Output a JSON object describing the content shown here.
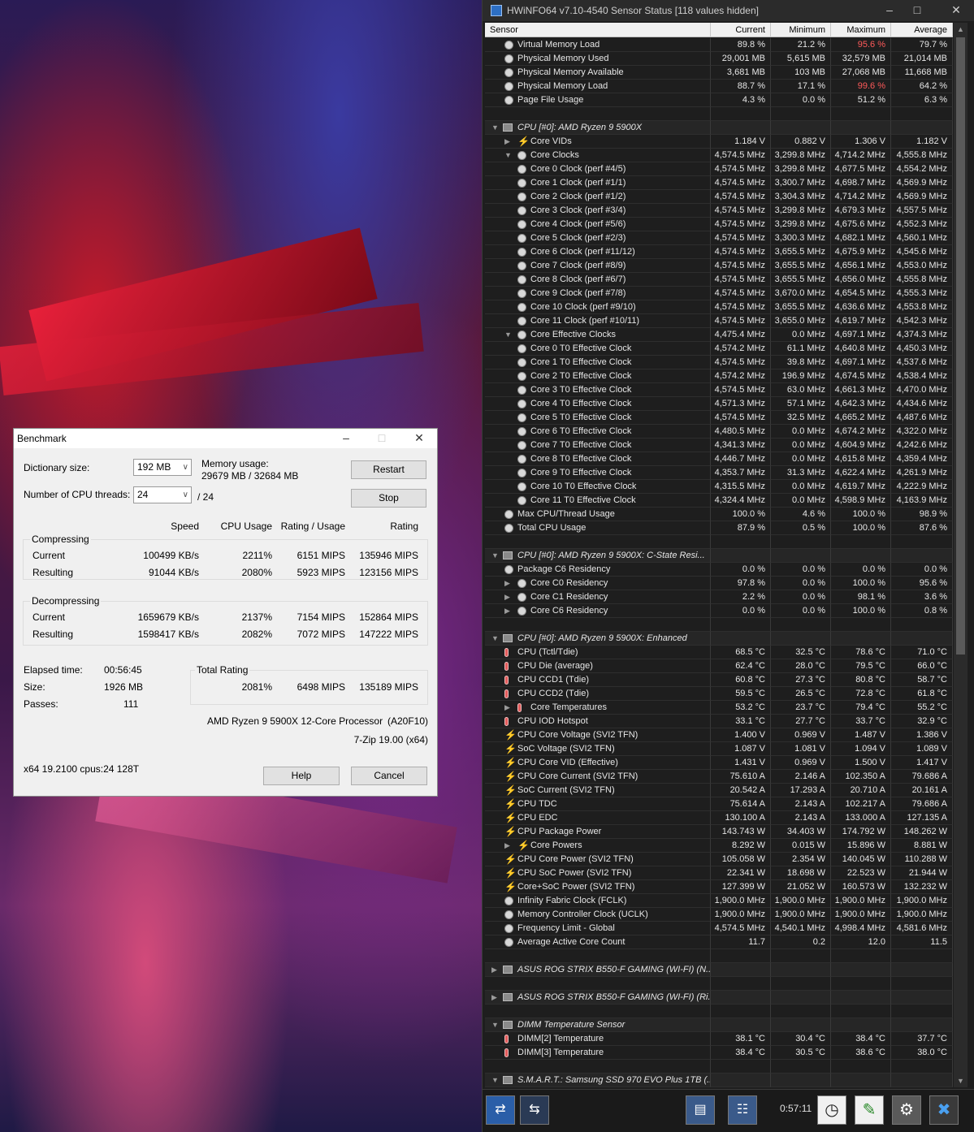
{
  "hwinfo": {
    "title": "HWiNFO64 v7.10-4540 Sensor Status [118 values hidden]",
    "columns": [
      "Sensor",
      "Current",
      "Minimum",
      "Maximum",
      "Average"
    ],
    "rows": [
      {
        "k": "s",
        "ic": "circ",
        "lv": 1,
        "n": "Virtual Memory Load",
        "v": [
          "89.8 %",
          "21.2 %",
          "95.6 %",
          "79.7 %"
        ],
        "hot": [
          false,
          false,
          true,
          false
        ]
      },
      {
        "k": "s",
        "ic": "circ",
        "lv": 1,
        "n": "Physical Memory Used",
        "v": [
          "29,001 MB",
          "5,615 MB",
          "32,579 MB",
          "21,014 MB"
        ]
      },
      {
        "k": "s",
        "ic": "circ",
        "lv": 1,
        "n": "Physical Memory Available",
        "v": [
          "3,681 MB",
          "103 MB",
          "27,068 MB",
          "11,668 MB"
        ]
      },
      {
        "k": "s",
        "ic": "circ",
        "lv": 1,
        "n": "Physical Memory Load",
        "v": [
          "88.7 %",
          "17.1 %",
          "99.6 %",
          "64.2 %"
        ],
        "hot": [
          false,
          false,
          true,
          false
        ]
      },
      {
        "k": "s",
        "ic": "circ",
        "lv": 1,
        "n": "Page File Usage",
        "v": [
          "4.3 %",
          "0.0 %",
          "51.2 %",
          "6.3 %"
        ]
      },
      {
        "k": "b"
      },
      {
        "k": "g",
        "n": "CPU [#0]: AMD Ryzen 9 5900X",
        "open": true
      },
      {
        "k": "s",
        "ic": "bolt",
        "lv": 2,
        "ar": "▶",
        "n": "Core VIDs",
        "v": [
          "1.184 V",
          "0.882 V",
          "1.306 V",
          "1.182 V"
        ]
      },
      {
        "k": "s",
        "ic": "circ",
        "lv": 2,
        "ar": "▼",
        "n": "Core Clocks",
        "v": [
          "4,574.5 MHz",
          "3,299.8 MHz",
          "4,714.2 MHz",
          "4,555.8 MHz"
        ]
      },
      {
        "k": "s",
        "ic": "circ",
        "lv": 3,
        "n": "Core 0 Clock (perf #4/5)",
        "v": [
          "4,574.5 MHz",
          "3,299.8 MHz",
          "4,677.5 MHz",
          "4,554.2 MHz"
        ]
      },
      {
        "k": "s",
        "ic": "circ",
        "lv": 3,
        "n": "Core 1 Clock (perf #1/1)",
        "v": [
          "4,574.5 MHz",
          "3,300.7 MHz",
          "4,698.7 MHz",
          "4,569.9 MHz"
        ]
      },
      {
        "k": "s",
        "ic": "circ",
        "lv": 3,
        "n": "Core 2 Clock (perf #1/2)",
        "v": [
          "4,574.5 MHz",
          "3,304.3 MHz",
          "4,714.2 MHz",
          "4,569.9 MHz"
        ]
      },
      {
        "k": "s",
        "ic": "circ",
        "lv": 3,
        "n": "Core 3 Clock (perf #3/4)",
        "v": [
          "4,574.5 MHz",
          "3,299.8 MHz",
          "4,679.3 MHz",
          "4,557.5 MHz"
        ]
      },
      {
        "k": "s",
        "ic": "circ",
        "lv": 3,
        "n": "Core 4 Clock (perf #5/6)",
        "v": [
          "4,574.5 MHz",
          "3,299.8 MHz",
          "4,675.6 MHz",
          "4,552.3 MHz"
        ]
      },
      {
        "k": "s",
        "ic": "circ",
        "lv": 3,
        "n": "Core 5 Clock (perf #2/3)",
        "v": [
          "4,574.5 MHz",
          "3,300.3 MHz",
          "4,682.1 MHz",
          "4,560.1 MHz"
        ]
      },
      {
        "k": "s",
        "ic": "circ",
        "lv": 3,
        "n": "Core 6 Clock (perf #11/12)",
        "v": [
          "4,574.5 MHz",
          "3,655.5 MHz",
          "4,675.9 MHz",
          "4,545.6 MHz"
        ]
      },
      {
        "k": "s",
        "ic": "circ",
        "lv": 3,
        "n": "Core 7 Clock (perf #8/9)",
        "v": [
          "4,574.5 MHz",
          "3,655.5 MHz",
          "4,656.1 MHz",
          "4,553.0 MHz"
        ]
      },
      {
        "k": "s",
        "ic": "circ",
        "lv": 3,
        "n": "Core 8 Clock (perf #6/7)",
        "v": [
          "4,574.5 MHz",
          "3,655.5 MHz",
          "4,656.0 MHz",
          "4,555.8 MHz"
        ]
      },
      {
        "k": "s",
        "ic": "circ",
        "lv": 3,
        "n": "Core 9 Clock (perf #7/8)",
        "v": [
          "4,574.5 MHz",
          "3,670.0 MHz",
          "4,654.5 MHz",
          "4,555.3 MHz"
        ]
      },
      {
        "k": "s",
        "ic": "circ",
        "lv": 3,
        "n": "Core 10 Clock (perf #9/10)",
        "v": [
          "4,574.5 MHz",
          "3,655.5 MHz",
          "4,636.6 MHz",
          "4,553.8 MHz"
        ]
      },
      {
        "k": "s",
        "ic": "circ",
        "lv": 3,
        "n": "Core 11 Clock (perf #10/11)",
        "v": [
          "4,574.5 MHz",
          "3,655.0 MHz",
          "4,619.7 MHz",
          "4,542.3 MHz"
        ]
      },
      {
        "k": "s",
        "ic": "circ",
        "lv": 2,
        "ar": "▼",
        "n": "Core Effective Clocks",
        "v": [
          "4,475.4 MHz",
          "0.0 MHz",
          "4,697.1 MHz",
          "4,374.3 MHz"
        ]
      },
      {
        "k": "s",
        "ic": "circ",
        "lv": 3,
        "n": "Core 0 T0 Effective Clock",
        "v": [
          "4,574.2 MHz",
          "61.1 MHz",
          "4,640.8 MHz",
          "4,450.3 MHz"
        ]
      },
      {
        "k": "s",
        "ic": "circ",
        "lv": 3,
        "n": "Core 1 T0 Effective Clock",
        "v": [
          "4,574.5 MHz",
          "39.8 MHz",
          "4,697.1 MHz",
          "4,537.6 MHz"
        ]
      },
      {
        "k": "s",
        "ic": "circ",
        "lv": 3,
        "n": "Core 2 T0 Effective Clock",
        "v": [
          "4,574.2 MHz",
          "196.9 MHz",
          "4,674.5 MHz",
          "4,538.4 MHz"
        ]
      },
      {
        "k": "s",
        "ic": "circ",
        "lv": 3,
        "n": "Core 3 T0 Effective Clock",
        "v": [
          "4,574.5 MHz",
          "63.0 MHz",
          "4,661.3 MHz",
          "4,470.0 MHz"
        ]
      },
      {
        "k": "s",
        "ic": "circ",
        "lv": 3,
        "n": "Core 4 T0 Effective Clock",
        "v": [
          "4,571.3 MHz",
          "57.1 MHz",
          "4,642.3 MHz",
          "4,434.6 MHz"
        ]
      },
      {
        "k": "s",
        "ic": "circ",
        "lv": 3,
        "n": "Core 5 T0 Effective Clock",
        "v": [
          "4,574.5 MHz",
          "32.5 MHz",
          "4,665.2 MHz",
          "4,487.6 MHz"
        ]
      },
      {
        "k": "s",
        "ic": "circ",
        "lv": 3,
        "n": "Core 6 T0 Effective Clock",
        "v": [
          "4,480.5 MHz",
          "0.0 MHz",
          "4,674.2 MHz",
          "4,322.0 MHz"
        ]
      },
      {
        "k": "s",
        "ic": "circ",
        "lv": 3,
        "n": "Core 7 T0 Effective Clock",
        "v": [
          "4,341.3 MHz",
          "0.0 MHz",
          "4,604.9 MHz",
          "4,242.6 MHz"
        ]
      },
      {
        "k": "s",
        "ic": "circ",
        "lv": 3,
        "n": "Core 8 T0 Effective Clock",
        "v": [
          "4,446.7 MHz",
          "0.0 MHz",
          "4,615.8 MHz",
          "4,359.4 MHz"
        ]
      },
      {
        "k": "s",
        "ic": "circ",
        "lv": 3,
        "n": "Core 9 T0 Effective Clock",
        "v": [
          "4,353.7 MHz",
          "31.3 MHz",
          "4,622.4 MHz",
          "4,261.9 MHz"
        ]
      },
      {
        "k": "s",
        "ic": "circ",
        "lv": 3,
        "n": "Core 10 T0 Effective Clock",
        "v": [
          "4,315.5 MHz",
          "0.0 MHz",
          "4,619.7 MHz",
          "4,222.9 MHz"
        ]
      },
      {
        "k": "s",
        "ic": "circ",
        "lv": 3,
        "n": "Core 11 T0 Effective Clock",
        "v": [
          "4,324.4 MHz",
          "0.0 MHz",
          "4,598.9 MHz",
          "4,163.9 MHz"
        ]
      },
      {
        "k": "s",
        "ic": "circ",
        "lv": 1,
        "n": "Max CPU/Thread Usage",
        "v": [
          "100.0 %",
          "4.6 %",
          "100.0 %",
          "98.9 %"
        ]
      },
      {
        "k": "s",
        "ic": "circ",
        "lv": 1,
        "n": "Total CPU Usage",
        "v": [
          "87.9 %",
          "0.5 %",
          "100.0 %",
          "87.6 %"
        ]
      },
      {
        "k": "b"
      },
      {
        "k": "g",
        "n": "CPU [#0]: AMD Ryzen 9 5900X: C-State Resi...",
        "open": true
      },
      {
        "k": "s",
        "ic": "circ",
        "lv": 1,
        "n": "Package C6 Residency",
        "v": [
          "0.0 %",
          "0.0 %",
          "0.0 %",
          "0.0 %"
        ]
      },
      {
        "k": "s",
        "ic": "circ",
        "lv": 2,
        "ar": "▶",
        "n": "Core C0 Residency",
        "v": [
          "97.8 %",
          "0.0 %",
          "100.0 %",
          "95.6 %"
        ]
      },
      {
        "k": "s",
        "ic": "circ",
        "lv": 2,
        "ar": "▶",
        "n": "Core C1 Residency",
        "v": [
          "2.2 %",
          "0.0 %",
          "98.1 %",
          "3.6 %"
        ]
      },
      {
        "k": "s",
        "ic": "circ",
        "lv": 2,
        "ar": "▶",
        "n": "Core C6 Residency",
        "v": [
          "0.0 %",
          "0.0 %",
          "100.0 %",
          "0.8 %"
        ]
      },
      {
        "k": "b"
      },
      {
        "k": "g",
        "n": "CPU [#0]: AMD Ryzen 9 5900X: Enhanced",
        "open": true
      },
      {
        "k": "s",
        "ic": "therm",
        "lv": 1,
        "n": "CPU (Tctl/Tdie)",
        "v": [
          "68.5 °C",
          "32.5 °C",
          "78.6 °C",
          "71.0 °C"
        ]
      },
      {
        "k": "s",
        "ic": "therm",
        "lv": 1,
        "n": "CPU Die (average)",
        "v": [
          "62.4 °C",
          "28.0 °C",
          "79.5 °C",
          "66.0 °C"
        ]
      },
      {
        "k": "s",
        "ic": "therm",
        "lv": 1,
        "n": "CPU CCD1 (Tdie)",
        "v": [
          "60.8 °C",
          "27.3 °C",
          "80.8 °C",
          "58.7 °C"
        ]
      },
      {
        "k": "s",
        "ic": "therm",
        "lv": 1,
        "n": "CPU CCD2 (Tdie)",
        "v": [
          "59.5 °C",
          "26.5 °C",
          "72.8 °C",
          "61.8 °C"
        ]
      },
      {
        "k": "s",
        "ic": "therm",
        "lv": 2,
        "ar": "▶",
        "n": "Core Temperatures",
        "v": [
          "53.2 °C",
          "23.7 °C",
          "79.4 °C",
          "55.2 °C"
        ]
      },
      {
        "k": "s",
        "ic": "therm",
        "lv": 1,
        "n": "CPU IOD Hotspot",
        "v": [
          "33.1 °C",
          "27.7 °C",
          "33.7 °C",
          "32.9 °C"
        ]
      },
      {
        "k": "s",
        "ic": "bolt",
        "lv": 1,
        "n": "CPU Core Voltage (SVI2 TFN)",
        "v": [
          "1.400 V",
          "0.969 V",
          "1.487 V",
          "1.386 V"
        ]
      },
      {
        "k": "s",
        "ic": "bolt",
        "lv": 1,
        "n": "SoC Voltage (SVI2 TFN)",
        "v": [
          "1.087 V",
          "1.081 V",
          "1.094 V",
          "1.089 V"
        ]
      },
      {
        "k": "s",
        "ic": "bolt",
        "lv": 1,
        "n": "CPU Core VID (Effective)",
        "v": [
          "1.431 V",
          "0.969 V",
          "1.500 V",
          "1.417 V"
        ]
      },
      {
        "k": "s",
        "ic": "bolt",
        "lv": 1,
        "n": "CPU Core Current (SVI2 TFN)",
        "v": [
          "75.610 A",
          "2.146 A",
          "102.350 A",
          "79.686 A"
        ]
      },
      {
        "k": "s",
        "ic": "bolt",
        "lv": 1,
        "n": "SoC Current (SVI2 TFN)",
        "v": [
          "20.542 A",
          "17.293 A",
          "20.710 A",
          "20.161 A"
        ]
      },
      {
        "k": "s",
        "ic": "bolt",
        "lv": 1,
        "n": "CPU TDC",
        "v": [
          "75.614 A",
          "2.143 A",
          "102.217 A",
          "79.686 A"
        ]
      },
      {
        "k": "s",
        "ic": "bolt",
        "lv": 1,
        "n": "CPU EDC",
        "v": [
          "130.100 A",
          "2.143 A",
          "133.000 A",
          "127.135 A"
        ]
      },
      {
        "k": "s",
        "ic": "bolt",
        "lv": 1,
        "n": "CPU Package Power",
        "v": [
          "143.743 W",
          "34.403 W",
          "174.792 W",
          "148.262 W"
        ]
      },
      {
        "k": "s",
        "ic": "bolt",
        "lv": 2,
        "ar": "▶",
        "n": "Core Powers",
        "v": [
          "8.292 W",
          "0.015 W",
          "15.896 W",
          "8.881 W"
        ]
      },
      {
        "k": "s",
        "ic": "bolt",
        "lv": 1,
        "n": "CPU Core Power (SVI2 TFN)",
        "v": [
          "105.058 W",
          "2.354 W",
          "140.045 W",
          "110.288 W"
        ]
      },
      {
        "k": "s",
        "ic": "bolt",
        "lv": 1,
        "n": "CPU SoC Power (SVI2 TFN)",
        "v": [
          "22.341 W",
          "18.698 W",
          "22.523 W",
          "21.944 W"
        ]
      },
      {
        "k": "s",
        "ic": "bolt",
        "lv": 1,
        "n": "Core+SoC Power (SVI2 TFN)",
        "v": [
          "127.399 W",
          "21.052 W",
          "160.573 W",
          "132.232 W"
        ]
      },
      {
        "k": "s",
        "ic": "circ",
        "lv": 1,
        "n": "Infinity Fabric Clock (FCLK)",
        "v": [
          "1,900.0 MHz",
          "1,900.0 MHz",
          "1,900.0 MHz",
          "1,900.0 MHz"
        ]
      },
      {
        "k": "s",
        "ic": "circ",
        "lv": 1,
        "n": "Memory Controller Clock (UCLK)",
        "v": [
          "1,900.0 MHz",
          "1,900.0 MHz",
          "1,900.0 MHz",
          "1,900.0 MHz"
        ]
      },
      {
        "k": "s",
        "ic": "circ",
        "lv": 1,
        "n": "Frequency Limit - Global",
        "v": [
          "4,574.5 MHz",
          "4,540.1 MHz",
          "4,998.4 MHz",
          "4,581.6 MHz"
        ]
      },
      {
        "k": "s",
        "ic": "circ",
        "lv": 1,
        "n": "Average Active Core Count",
        "v": [
          "11.7",
          "0.2",
          "12.0",
          "11.5"
        ]
      },
      {
        "k": "b"
      },
      {
        "k": "g",
        "n": "ASUS ROG STRIX B550-F GAMING (WI-FI) (N...",
        "open": false
      },
      {
        "k": "b"
      },
      {
        "k": "g",
        "n": "ASUS ROG STRIX B550-F GAMING (WI-FI) (Ri...",
        "open": false
      },
      {
        "k": "b"
      },
      {
        "k": "g",
        "n": "DIMM Temperature Sensor",
        "open": true
      },
      {
        "k": "s",
        "ic": "therm",
        "lv": 1,
        "n": "DIMM[2] Temperature",
        "v": [
          "38.1 °C",
          "30.4 °C",
          "38.4 °C",
          "37.7 °C"
        ]
      },
      {
        "k": "s",
        "ic": "therm",
        "lv": 1,
        "n": "DIMM[3] Temperature",
        "v": [
          "38.4 °C",
          "30.5 °C",
          "38.6 °C",
          "38.0 °C"
        ]
      },
      {
        "k": "b"
      },
      {
        "k": "g",
        "n": "S.M.A.R.T.: Samsung SSD 970 EVO Plus 1TB (...",
        "open": true
      }
    ],
    "toolbar": {
      "timer": "0:57:11"
    },
    "icons": [
      "arrows-left-right-icon",
      "arrows-collapse-icon",
      "monitor-report-icon",
      "network-icon",
      "clock-icon",
      "log-file-icon",
      "settings-gear-icon",
      "close-x-icon"
    ]
  },
  "bench": {
    "title": "Benchmark",
    "dict_label": "Dictionary size:",
    "dict_value": "192 MB",
    "mem_label": "Memory usage:",
    "mem_value": "29679 MB / 32684 MB",
    "threads_label": "Number of CPU threads:",
    "threads_value": "24",
    "threads_max": "/ 24",
    "restart": "Restart",
    "stop": "Stop",
    "headers": {
      "speed": "Speed",
      "cpu": "CPU Usage",
      "rpu": "Rating / Usage",
      "rating": "Rating"
    },
    "compressing": {
      "label": "Compressing",
      "current": {
        "label": "Current",
        "speed": "100499 KB/s",
        "cpu": "2211%",
        "rpu": "6151 MIPS",
        "rating": "135946 MIPS"
      },
      "resulting": {
        "label": "Resulting",
        "speed": "91044 KB/s",
        "cpu": "2080%",
        "rpu": "5923 MIPS",
        "rating": "123156 MIPS"
      }
    },
    "decompressing": {
      "label": "Decompressing",
      "current": {
        "label": "Current",
        "speed": "1659679 KB/s",
        "cpu": "2137%",
        "rpu": "7154 MIPS",
        "rating": "152864 MIPS"
      },
      "resulting": {
        "label": "Resulting",
        "speed": "1598417 KB/s",
        "cpu": "2082%",
        "rpu": "7072 MIPS",
        "rating": "147222 MIPS"
      }
    },
    "elapsed_label": "Elapsed time:",
    "elapsed": "00:56:45",
    "size_label": "Size:",
    "size": "1926 MB",
    "passes_label": "Passes:",
    "passes": "111",
    "total_label": "Total Rating",
    "total": {
      "cpu": "2081%",
      "rpu": "6498 MIPS",
      "rating": "135189 MIPS"
    },
    "cpu_name": "AMD Ryzen 9 5900X 12-Core Processor",
    "cpu_id": "(A20F10)",
    "version": "7-Zip 19.00 (x64)",
    "build": "x64 19.2100 cpus:24 128T",
    "help": "Help",
    "cancel": "Cancel"
  }
}
